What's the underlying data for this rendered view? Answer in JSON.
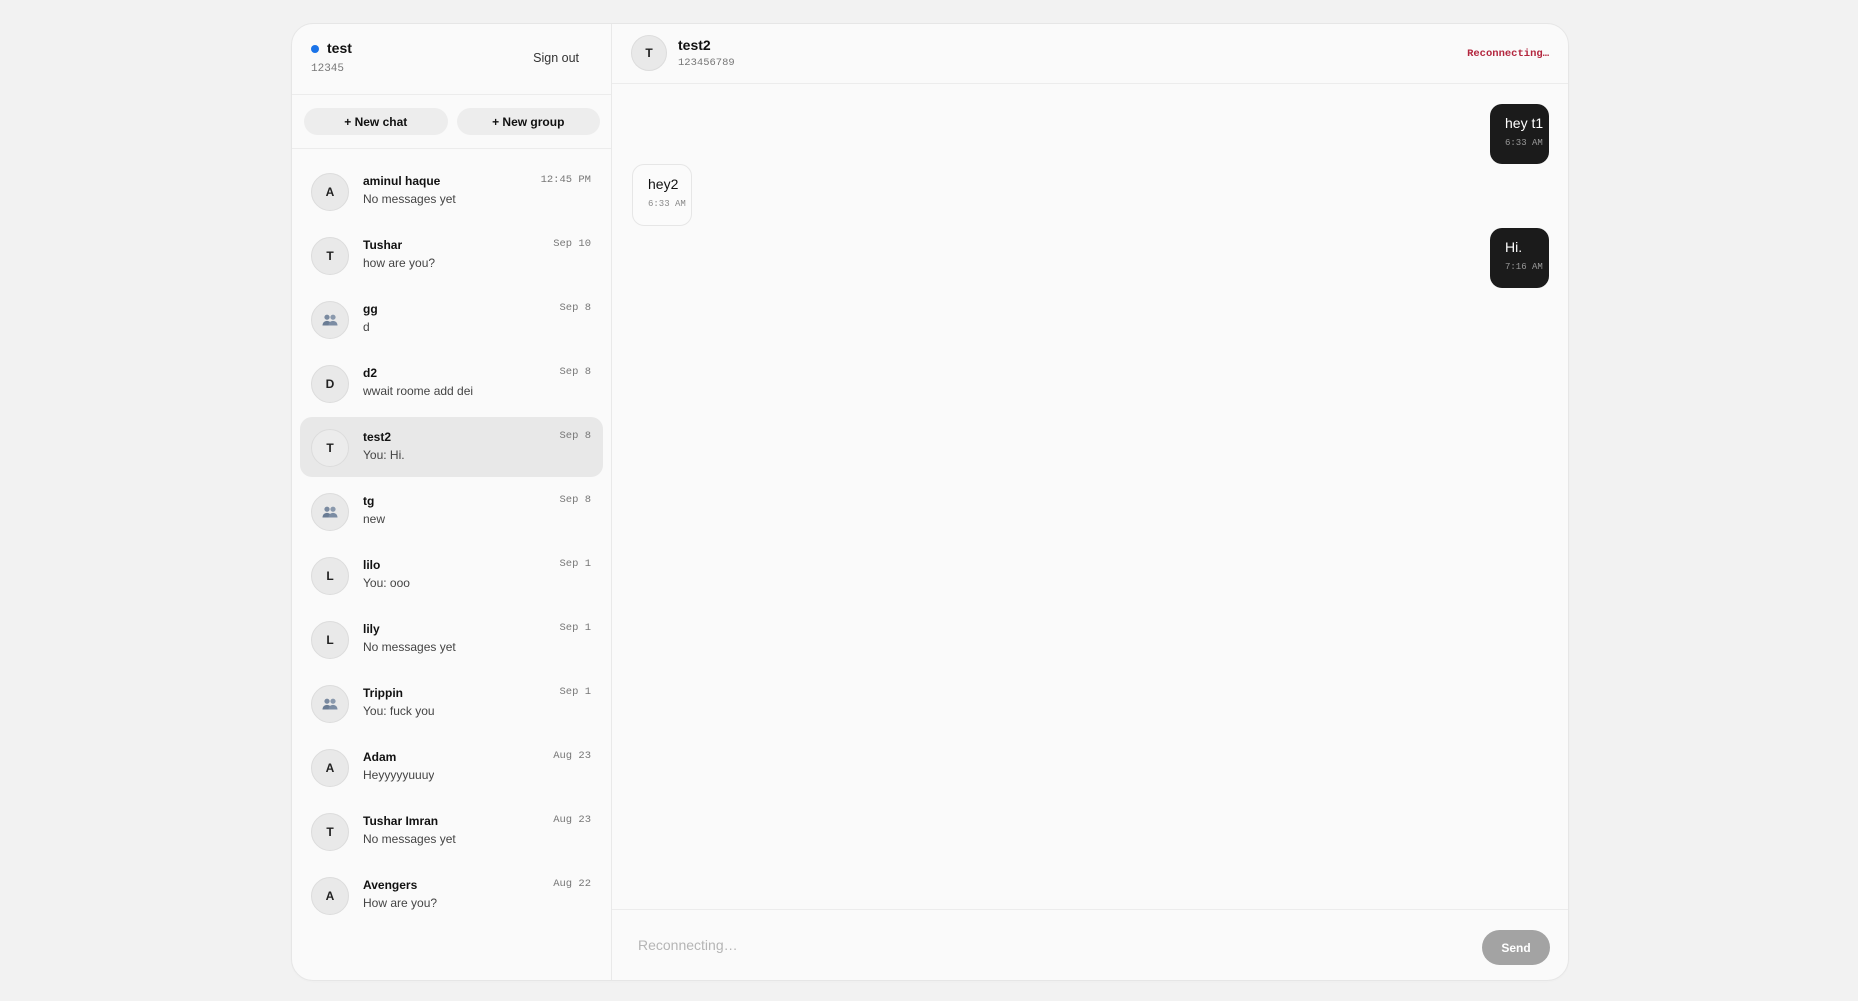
{
  "me": {
    "name": "test",
    "id": "12345",
    "sign_out_label": "Sign out"
  },
  "actions": {
    "new_chat": "+ New chat",
    "new_group": "+ New group"
  },
  "chats": [
    {
      "initial": "A",
      "is_group": false,
      "name": "aminul haque",
      "preview": "No messages yet",
      "time": "12:45 PM",
      "active": false
    },
    {
      "initial": "T",
      "is_group": false,
      "name": "Tushar",
      "preview": "how are you?",
      "time": "Sep 10",
      "active": false
    },
    {
      "initial": "",
      "is_group": true,
      "name": "gg",
      "preview": "d",
      "time": "Sep 8",
      "active": false
    },
    {
      "initial": "D",
      "is_group": false,
      "name": "d2",
      "preview": "wwait roome add dei",
      "time": "Sep 8",
      "active": false
    },
    {
      "initial": "T",
      "is_group": false,
      "name": "test2",
      "preview": "You: Hi.",
      "time": "Sep 8",
      "active": true
    },
    {
      "initial": "",
      "is_group": true,
      "name": "tg",
      "preview": "new",
      "time": "Sep 8",
      "active": false
    },
    {
      "initial": "L",
      "is_group": false,
      "name": "lilo",
      "preview": "You: ooo",
      "time": "Sep 1",
      "active": false
    },
    {
      "initial": "L",
      "is_group": false,
      "name": "lily",
      "preview": "No messages yet",
      "time": "Sep 1",
      "active": false
    },
    {
      "initial": "",
      "is_group": true,
      "name": "Trippin",
      "preview": "You: fuck you",
      "time": "Sep 1",
      "active": false
    },
    {
      "initial": "A",
      "is_group": false,
      "name": "Adam",
      "preview": "Heyyyyyuuuy",
      "time": "Aug 23",
      "active": false
    },
    {
      "initial": "T",
      "is_group": false,
      "name": "Tushar Imran",
      "preview": "No messages yet",
      "time": "Aug 23",
      "active": false
    },
    {
      "initial": "A",
      "is_group": false,
      "name": "Avengers",
      "preview": "How are you?",
      "time": "Aug 22",
      "active": false
    }
  ],
  "conversation": {
    "initial": "T",
    "name": "test2",
    "id": "123456789",
    "status": "Reconnecting…",
    "messages": [
      {
        "direction": "sent",
        "text": "hey t1",
        "time": "6:33 AM"
      },
      {
        "direction": "received",
        "text": "hey2",
        "time": "6:33 AM"
      },
      {
        "direction": "sent",
        "text": "Hi.",
        "time": "7:16 AM"
      }
    ]
  },
  "composer": {
    "placeholder": "Reconnecting…",
    "send_label": "Send"
  },
  "colors": {
    "accent_dot": "#1a73e8",
    "status_text": "#b3263e",
    "sent_bubble": "#1b1b1b",
    "send_button": "#a3a3a3"
  }
}
